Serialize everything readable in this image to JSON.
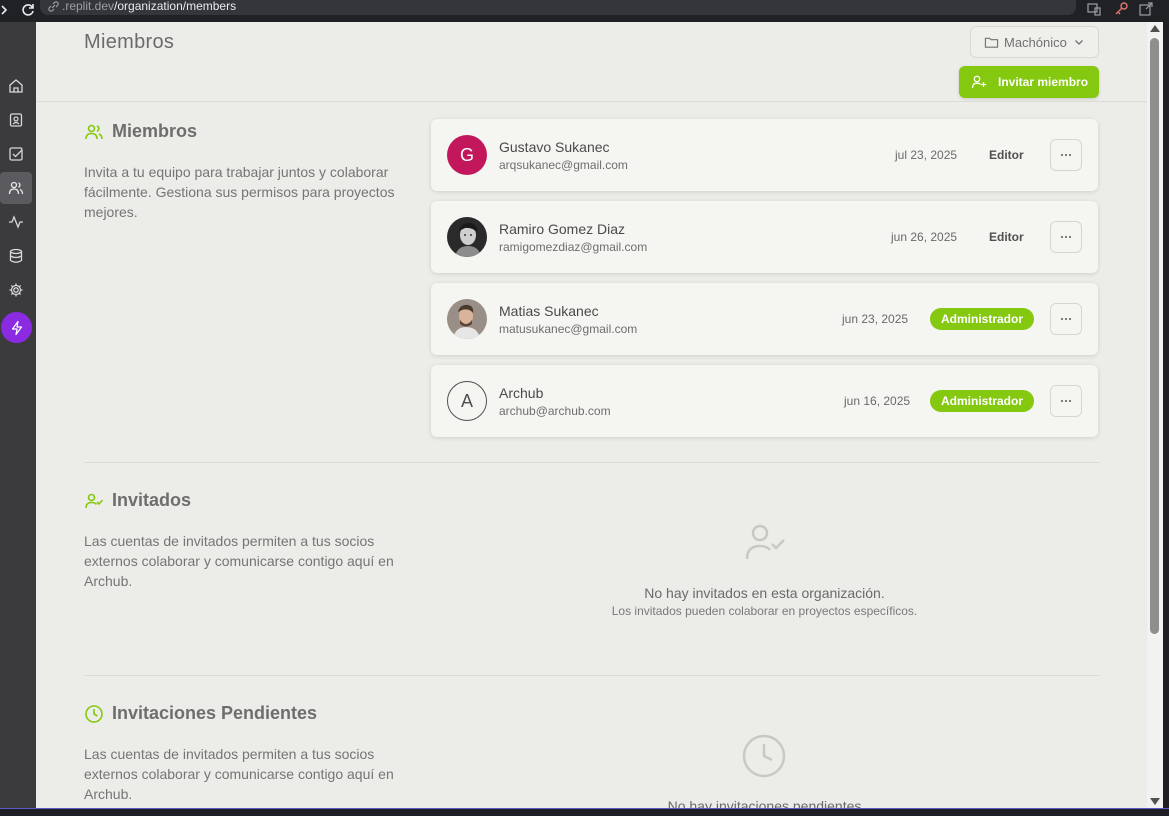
{
  "browser": {
    "url_prefix": ".replit.dev",
    "url_path": "/organization/members"
  },
  "sidebar": {
    "items": [
      {
        "name": "home",
        "icon": "home-icon",
        "active": false
      },
      {
        "name": "contacts",
        "icon": "contact-card-icon",
        "active": false
      },
      {
        "name": "tasks",
        "icon": "checkbox-icon",
        "active": false
      },
      {
        "name": "members",
        "icon": "users-icon",
        "active": true
      },
      {
        "name": "activity",
        "icon": "activity-icon",
        "active": false
      },
      {
        "name": "database",
        "icon": "database-icon",
        "active": false
      },
      {
        "name": "settings",
        "icon": "gear-icon",
        "active": false
      },
      {
        "name": "upgrade",
        "icon": "bolt-icon",
        "active": false
      }
    ]
  },
  "header": {
    "title": "Miembros",
    "project_select": "Machónico",
    "invite_button": "Invitar miembro"
  },
  "colors": {
    "accent": "#84c90f",
    "avatar_g": "#c2185b",
    "bolt_bg": "#8a2be2"
  },
  "members_section": {
    "heading": "Miembros",
    "description": "Invita a tu equipo para trabajar juntos y colaborar fácilmente. Gestiona sus permisos para proyectos mejores.",
    "members": [
      {
        "initial": "G",
        "name": "Gustavo Sukanec",
        "email": "arqsukanec@gmail.com",
        "date": "jul 23, 2025",
        "role": "Editor"
      },
      {
        "initial": "",
        "name": "Ramiro Gomez Diaz",
        "email": "ramigomezdiaz@gmail.com",
        "date": "jun 26, 2025",
        "role": "Editor"
      },
      {
        "initial": "",
        "name": "Matias Sukanec",
        "email": "matusukanec@gmail.com",
        "date": "jun 23, 2025",
        "role": "Administrador"
      },
      {
        "initial": "A",
        "name": "Archub",
        "email": "archub@archub.com",
        "date": "jun 16, 2025",
        "role": "Administrador"
      }
    ]
  },
  "guests_section": {
    "heading": "Invitados",
    "description": "Las cuentas de invitados permiten a tus socios externos colaborar y comunicarse contigo aquí en Archub.",
    "empty_title": "No hay invitados en esta organización.",
    "empty_subtitle": "Los invitados pueden colaborar en proyectos específicos."
  },
  "pending_section": {
    "heading": "Invitaciones Pendientes",
    "description": "Las cuentas de invitados permiten a tus socios externos colaborar y comunicarse contigo aquí en Archub.",
    "empty_title": "No hay invitaciones pendientes"
  }
}
